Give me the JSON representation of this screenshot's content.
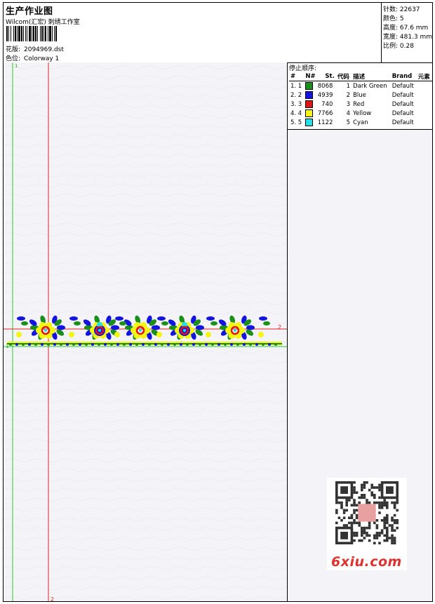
{
  "header": {
    "title": "生产作业图",
    "subtitle": "Wilcom(汇宏) 刺绣工作室",
    "design_label": "花版:",
    "design_value": "2094969.dst",
    "colorway_label": "色位:",
    "colorway_value": "Colorway 1"
  },
  "stats": {
    "stitches": "针数: 22637",
    "colors": "颜色: 5",
    "height": "高度: 67.6 mm",
    "width": "宽度: 481.3 mm",
    "scale": "比例: 0.28"
  },
  "stop_panel": {
    "title": "停止顺序:",
    "columns": [
      "#",
      "N#",
      "St.",
      "代码",
      "描述",
      "Brand",
      "元素"
    ],
    "rows": [
      {
        "idx": "1. 1",
        "color": "#1a8f1a",
        "st": "8068",
        "code": "1",
        "desc": "Dark Green",
        "brand": "Default"
      },
      {
        "idx": "2. 2",
        "color": "#1414e0",
        "st": "4939",
        "code": "2",
        "desc": "Blue",
        "brand": "Default"
      },
      {
        "idx": "3. 3",
        "color": "#e01414",
        "st": "740",
        "code": "3",
        "desc": "Red",
        "brand": "Default"
      },
      {
        "idx": "4. 4",
        "color": "#f5f514",
        "st": "7766",
        "code": "4",
        "desc": "Yellow",
        "brand": "Default"
      },
      {
        "idx": "5. 5",
        "color": "#20e0e8",
        "st": "1122",
        "code": "5",
        "desc": "Cyan",
        "brand": "Default"
      }
    ]
  },
  "canvas": {
    "marker_top_left": "1",
    "marker_right": "2",
    "marker_left": "1",
    "marker_bottom": "2"
  },
  "watermark": {
    "site": "6xiu.com"
  }
}
